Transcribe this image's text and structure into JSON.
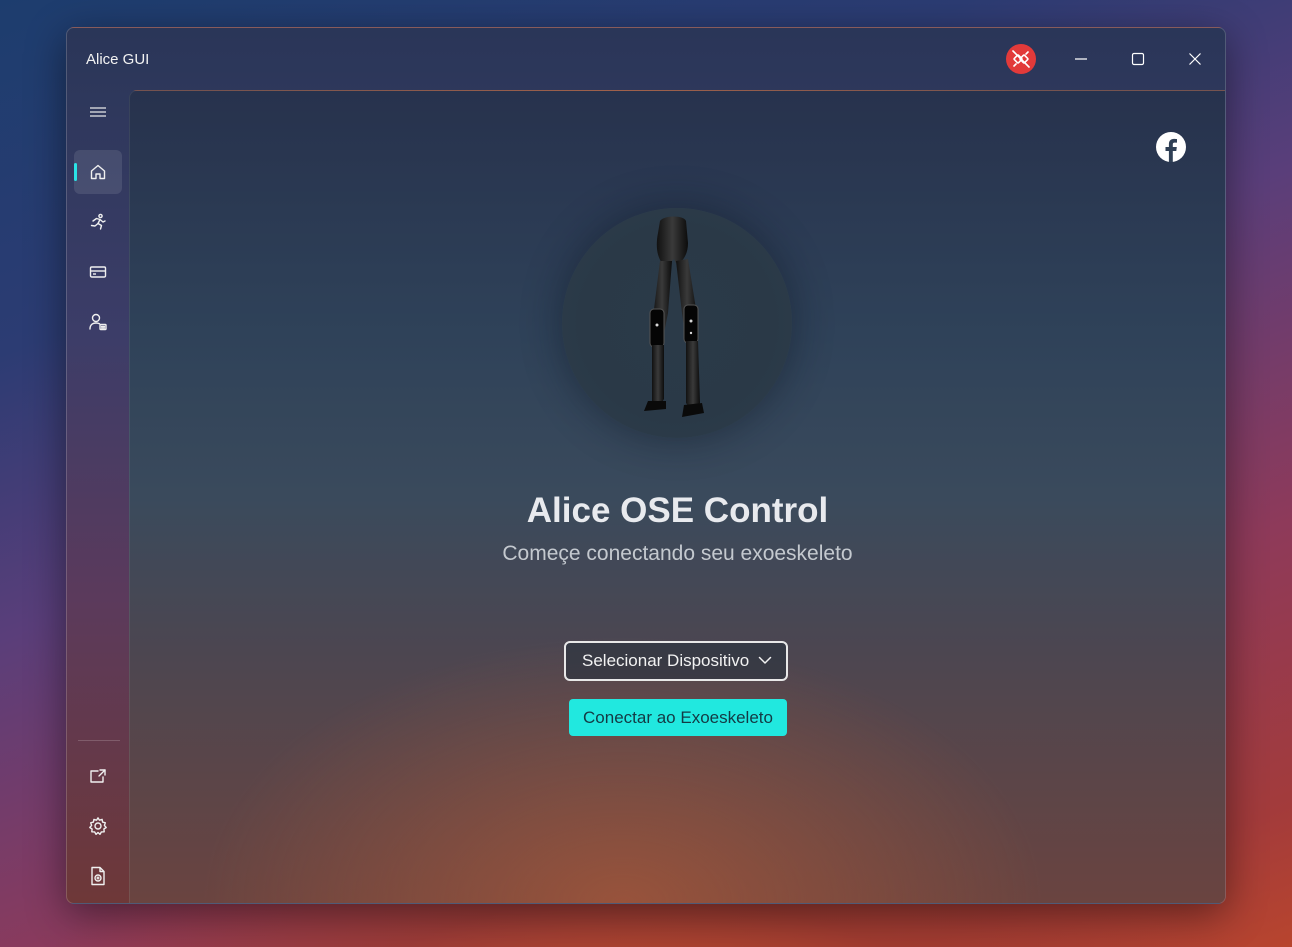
{
  "window": {
    "title": "Alice GUI"
  },
  "titlebar": {
    "status_icon": "plug-disconnected-icon",
    "status_color": "#e23a3a",
    "minimize_icon": "minimize-icon",
    "maximize_icon": "maximize-icon",
    "close_icon": "close-icon"
  },
  "sidebar": {
    "menu_icon": "hamburger-icon",
    "items": [
      {
        "icon": "home-icon",
        "active": true
      },
      {
        "icon": "running-person-icon",
        "active": false
      },
      {
        "icon": "card-icon",
        "active": false
      },
      {
        "icon": "person-settings-icon",
        "active": false
      }
    ],
    "footer_items": [
      {
        "icon": "open-external-icon"
      },
      {
        "icon": "gear-icon"
      },
      {
        "icon": "document-icon"
      }
    ],
    "accent": "#2be3e6"
  },
  "main": {
    "social_icon": "facebook-icon",
    "image": "exoskeleton-legs",
    "headline": "Alice OSE Control",
    "subline": "Começe conectando seu exoeskeleto",
    "device_select": {
      "value": "Selecionar Dispositivo"
    },
    "connect_button": {
      "label": "Conectar ao Exoeskeleto",
      "color": "#21e8df"
    }
  }
}
